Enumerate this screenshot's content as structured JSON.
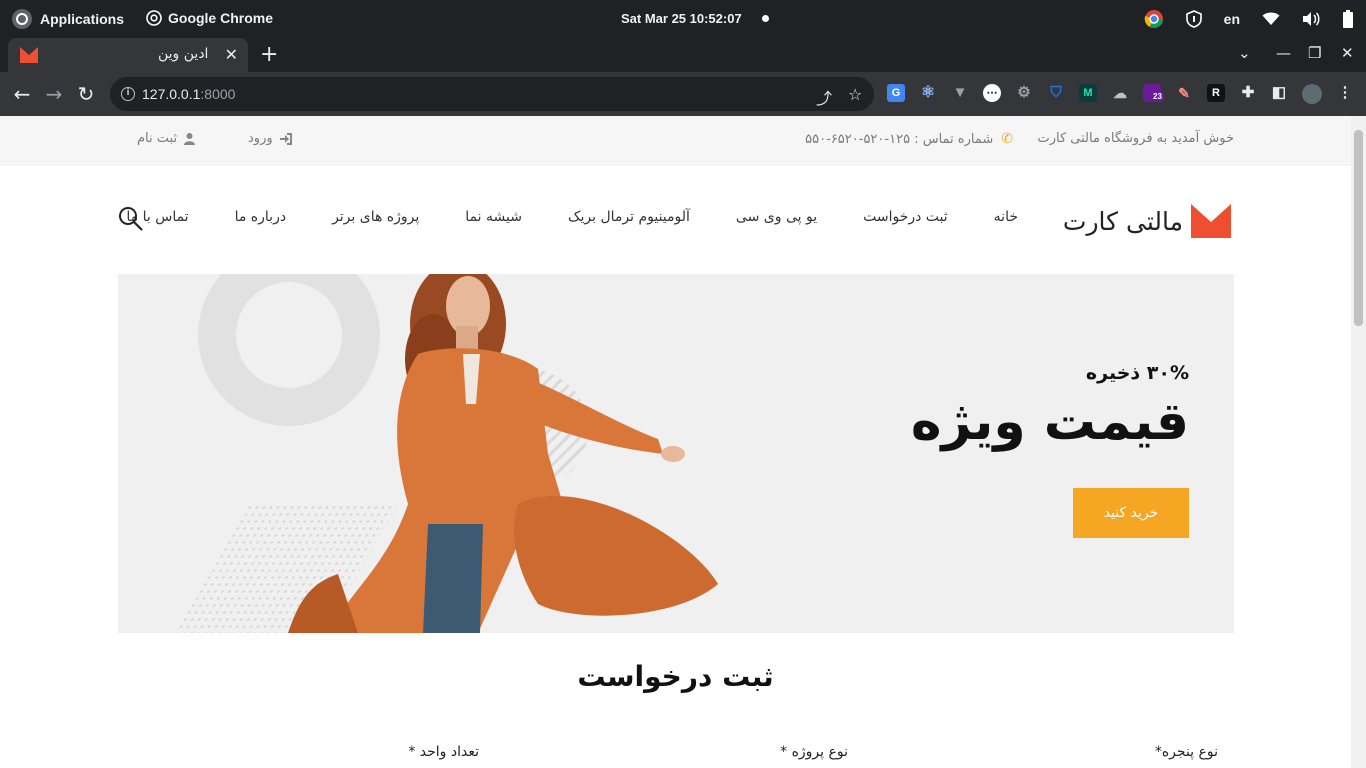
{
  "os": {
    "applications": "Applications",
    "browser_name": "Google Chrome",
    "clock": "Sat Mar 25  10:52:07",
    "language": "en"
  },
  "browser": {
    "tab_title": "ادین وین",
    "url_host": "127.0.0.1",
    "url_port": ":8000",
    "extension_badge": "23",
    "extension_r": "R"
  },
  "site": {
    "welcome": "خوش آمدید به فروشگاه مالتی کارت",
    "phone_label": "شماره تماس : ۱۲۵-۵۲۰-۶۵۲۰-۵۵۰",
    "login": "ورود",
    "register": "ثبت نام",
    "brand": "مالتی کارت",
    "brand_color": "#f04e31",
    "accent_color": "#f5a623",
    "menu": [
      {
        "label": "خانه"
      },
      {
        "label": "ثبت درخواست"
      },
      {
        "label": "یو پی وی سی"
      },
      {
        "label": "آلومینیوم ترمال بریک"
      },
      {
        "label": "شیشه نما"
      },
      {
        "label": "پروژه های برتر"
      },
      {
        "label": "درباره ما"
      },
      {
        "label": "تماس با ما"
      }
    ]
  },
  "hero": {
    "save": "۳۰% ذخیره",
    "headline": "قیمت ویژه",
    "button": "خرید کنید"
  },
  "request_form": {
    "title": "ثبت درخواست",
    "window_type_label": "نوع پنجره*",
    "project_type_label": "نوع پروژه *",
    "unit_count_label": "تعداد واحد *"
  }
}
